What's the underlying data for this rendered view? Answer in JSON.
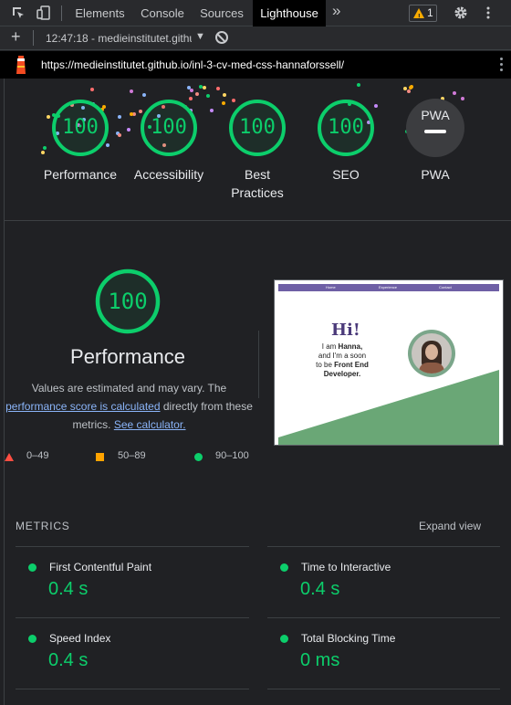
{
  "devtools": {
    "tabs": [
      "Elements",
      "Console",
      "Sources",
      "Lighthouse"
    ],
    "active_tab": "Lighthouse",
    "overflow": "»",
    "warning_count": "1"
  },
  "toolbar": {
    "add": "+",
    "report_select": "12:47:18 - medieinstitutet.githu",
    "dropdown_arrow": "▼"
  },
  "url": {
    "text": "https://medieinstitutet.github.io/inl-3-cv-med-css-hannaforssell/"
  },
  "scores": [
    {
      "label": "Performance",
      "value": "100"
    },
    {
      "label": "Accessibility",
      "value": "100"
    },
    {
      "label": "Best Practices",
      "value": "100"
    },
    {
      "label": "SEO",
      "value": "100"
    },
    {
      "label": "PWA",
      "value": "PWA"
    }
  ],
  "performance": {
    "score": "100",
    "title": "Performance",
    "desc_1": "Values are estimated and may vary. The",
    "link_1": "performance score is calculated",
    "desc_2": " directly from these",
    "desc_3": "metrics. ",
    "link_2": "See calculator.",
    "legend": [
      {
        "range": "0–49",
        "color": "#ff4e42"
      },
      {
        "range": "50–89",
        "color": "#ffa400"
      },
      {
        "range": "90–100",
        "color": "#0cce6b"
      }
    ]
  },
  "thumbnail": {
    "nav": [
      "Home",
      "Experience",
      "Contact"
    ],
    "hi": "Hi!",
    "intro_1": "I am ",
    "name": "Hanna,",
    "intro_2": "and I'm a soon to be ",
    "role": "Front End Developer."
  },
  "metrics": {
    "heading": "METRICS",
    "expand": "Expand view",
    "items": [
      {
        "label": "First Contentful Paint",
        "value": "0.4 s"
      },
      {
        "label": "Time to Interactive",
        "value": "0.4 s"
      },
      {
        "label": "Speed Index",
        "value": "0.4 s"
      },
      {
        "label": "Total Blocking Time",
        "value": "0 ms"
      }
    ]
  },
  "colors": {
    "pass": "#0cce6b",
    "link": "#8ab4f8",
    "background": "#202124"
  }
}
